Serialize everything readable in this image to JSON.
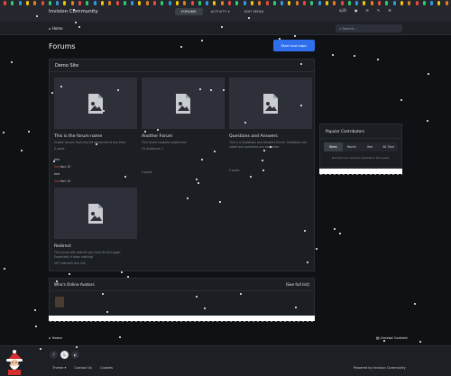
{
  "header": {
    "brand": "Invision Community",
    "nav": [
      {
        "label": "FORUMS",
        "active": true
      },
      {
        "label": "ACTIVITY ▾",
        "active": false
      },
      {
        "label": "EDIT MENU",
        "active": false
      }
    ],
    "user_name": "ajilli"
  },
  "subbar": {
    "breadcrumb": "Home",
    "search_placeholder": "Search..."
  },
  "page": {
    "title": "Forums",
    "start_button": "Start new topic"
  },
  "forum_category": {
    "title": "Demo Site",
    "forums": [
      {
        "title": "This is the forum name",
        "description": "Create forums that may be enhanced at any time.",
        "meta": "2 posts",
        "posts": [
          {
            "title": "test",
            "by": "Sep",
            "date": "Nov 15"
          },
          {
            "title": "test",
            "by": "Sep",
            "date": "Nov 15"
          }
        ]
      },
      {
        "title": "Another Forum",
        "description": "This forum contains subforums",
        "meta": "Ov Subforum 1",
        "posts": [],
        "footer": "0 posts"
      },
      {
        "title": "Questions and Answers",
        "description": "This is a Questions and Answers forum. Questions are voted and questions are answered.",
        "meta": "",
        "posts": [],
        "footer": "0 posts"
      },
      {
        "title": "Redirect",
        "description": "This forum will redirect you (and for this page, Essentially it does nothing)",
        "meta": "197 redirects this link",
        "posts": []
      }
    ]
  },
  "popular_contributors": {
    "title": "Popular Contributors",
    "tabs": [
      "Week",
      "Month",
      "Year",
      "All Time"
    ],
    "active_tab": "Week",
    "empty_text": "Nobody has received reputation this week."
  },
  "whos_online": {
    "title": "Who's Online Avatars",
    "see_all": "(See full list)"
  },
  "footer": {
    "breadcrumb": "Home",
    "unread": "Unread Content",
    "links": [
      "Theme ▾",
      "Contact Us",
      "Cookies"
    ],
    "powered": "Powered by Invision Community"
  },
  "colors": {
    "accent": "#2f6fed",
    "background": "#0f1114",
    "panel": "#1b1e23",
    "highlight_red": "#d94848"
  },
  "icons": [
    "image-placeholder-icon",
    "home-icon",
    "bell-icon",
    "envelope-icon",
    "search-icon",
    "santa-icon"
  ]
}
